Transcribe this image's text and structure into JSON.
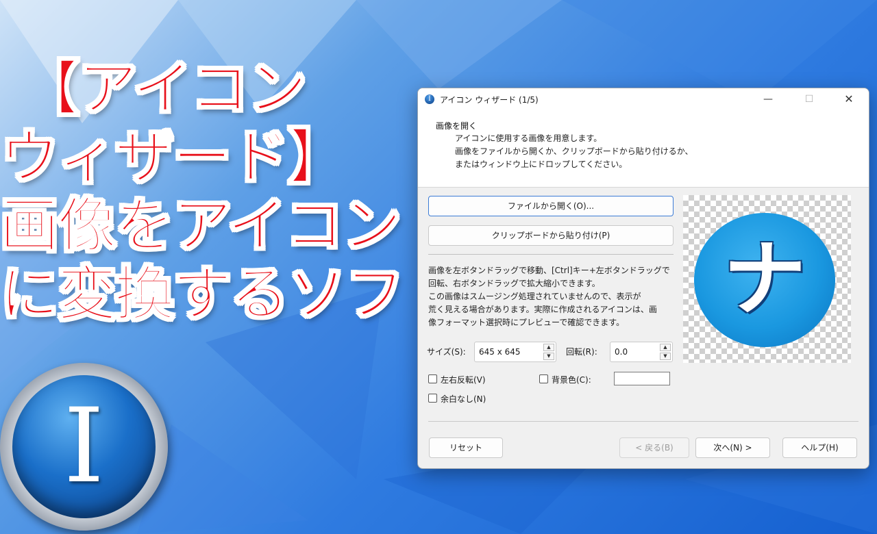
{
  "overlay": {
    "line1": "【アイコン",
    "line2": "ウィザード】",
    "line3": "画像をアイコン",
    "line4": "に変換するソフト",
    "logo_letter": "I"
  },
  "window": {
    "title": "アイコン ウィザード (1/5)",
    "icon_letter": "I",
    "minimize": "—",
    "maximize": "☐",
    "close": "✕"
  },
  "header": {
    "title": "画像を開く",
    "description": "アイコンに使用する画像を用意します。\n画像をファイルから開くか、クリップボードから貼り付けるか、\nまたはウィンドウ上にドロップしてください。"
  },
  "actions": {
    "open_file": "ファイルから開く(O)...",
    "paste_clipboard": "クリップボードから貼り付け(P)"
  },
  "help_text": "画像を左ボタンドラッグで移動、[Ctrl]キー+左ボタンドラッグで\n回転、右ボタンドラッグで拡大縮小できます。\nこの画像はスムージング処理されていませんので、表示が\n荒く見える場合があります。実際に作成されるアイコンは、画\n像フォーマット選択時にプレビューで確認できます。",
  "controls": {
    "size_label": "サイズ(S):",
    "size_value": "645 x 645",
    "rotation_label": "回転(R):",
    "rotation_value": "0.0",
    "flip_label": "左右反転(V)",
    "flip_checked": false,
    "bgcolor_label": "背景色(C):",
    "bgcolor_checked": false,
    "bgcolor_value": "#ffffff",
    "no_margin_label": "余白なし(N)",
    "no_margin_checked": false
  },
  "preview": {
    "glyph": "ナ",
    "circle_color": "#1a98e0"
  },
  "footer": {
    "reset": "リセット",
    "back": "< 戻る(B)",
    "next": "次へ(N) >",
    "help": "ヘルプ(H)"
  },
  "colors": {
    "title_red": "#e8101a",
    "accent_border": "#3b7bd6"
  }
}
